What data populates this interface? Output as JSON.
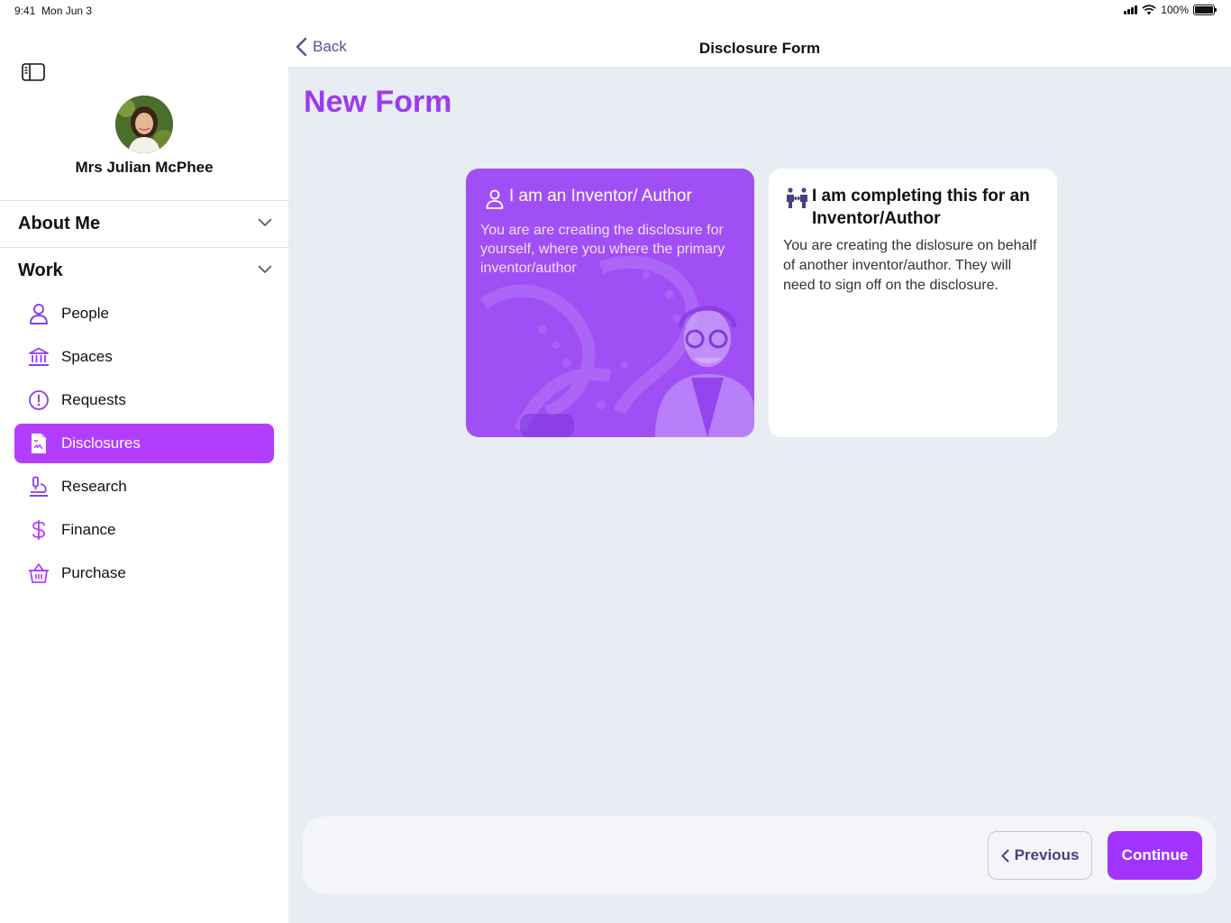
{
  "status_bar": {
    "time": "9:41",
    "date": "Mon Jun 3",
    "battery": "100%"
  },
  "sidebar": {
    "user_name": "Mrs Julian McPhee",
    "sections": [
      {
        "title": "About Me"
      },
      {
        "title": "Work"
      }
    ],
    "items": [
      {
        "label": "People",
        "icon": "person-icon"
      },
      {
        "label": "Spaces",
        "icon": "bank-icon"
      },
      {
        "label": "Requests",
        "icon": "exclamation-circle-icon"
      },
      {
        "label": "Disclosures",
        "icon": "document-icon",
        "active": true
      },
      {
        "label": "Research",
        "icon": "microscope-icon"
      },
      {
        "label": "Finance",
        "icon": "dollar-icon"
      },
      {
        "label": "Purchase",
        "icon": "basket-icon"
      }
    ]
  },
  "header": {
    "back_label": "Back",
    "title": "Disclosure Form"
  },
  "main": {
    "page_title": "New Form",
    "options": [
      {
        "title": "I am an Inventor/ Author",
        "description": "You are are creating the disclosure for yourself, where you where the primary inventor/author",
        "selected": true
      },
      {
        "title": "I am completing this for an Inventor/Author",
        "description": "You are creating the dislosure on behalf of another inventor/author. They will need to sign off on the disclosure.",
        "selected": false
      }
    ]
  },
  "footer": {
    "previous_label": "Previous",
    "continue_label": "Continue"
  },
  "colors": {
    "accent": "#a233ff",
    "title": "#9b3bf0",
    "active_nav": "#b33dff",
    "background": "#e8ecf3"
  }
}
